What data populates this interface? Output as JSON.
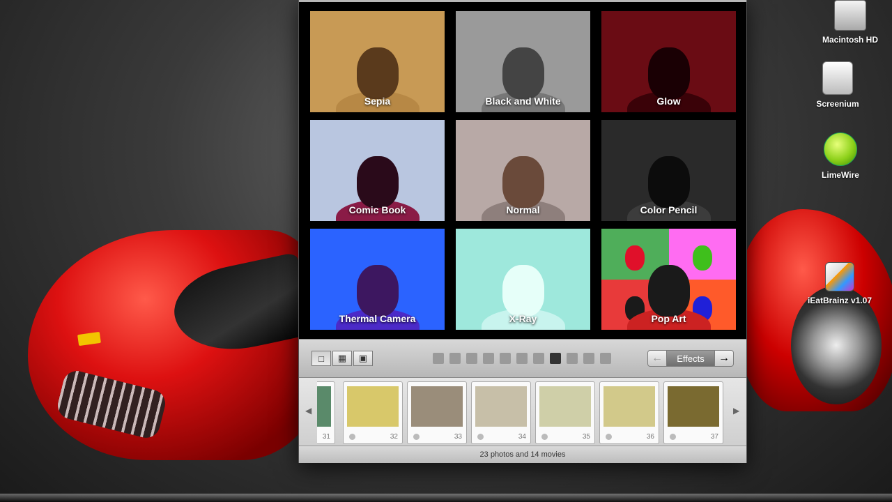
{
  "desktop": {
    "icons": [
      {
        "name": "Macintosh HD"
      },
      {
        "name": "Screenium"
      },
      {
        "name": "LimeWire"
      },
      {
        "name": "iEatBrainz v1.07"
      }
    ]
  },
  "effects": [
    {
      "label": "Sepia",
      "bg": "#c89a55",
      "face": "#5a3a1c",
      "shirt": "#b78845"
    },
    {
      "label": "Black and White",
      "bg": "#9a9a9a",
      "face": "#444444",
      "shirt": "#777777"
    },
    {
      "label": "Glow",
      "bg": "#6a0c14",
      "face": "#1a0004",
      "shirt": "#3a0208"
    },
    {
      "label": "Comic Book",
      "bg": "#b9c6e0",
      "face": "#2a0a1a",
      "shirt": "#8a1b46"
    },
    {
      "label": "Normal",
      "bg": "#b8a9a6",
      "face": "#6a4a3a",
      "shirt": "#8e7f7c"
    },
    {
      "label": "Color Pencil",
      "bg": "#2a2a2a",
      "face": "#0c0c0c",
      "shirt": "#3c3c3c"
    },
    {
      "label": "Thermal Camera",
      "bg": "#2b63ff",
      "face": "#3d1760",
      "shirt": "#4b2ac8"
    },
    {
      "label": "X-Ray",
      "bg": "#9ee8dc",
      "face": "#e6fff9",
      "shirt": "#c8f4ee"
    },
    {
      "label": "Pop Art",
      "bg": "#e83a3a",
      "face": "#1a1a1a",
      "shirt": "#c22"
    }
  ],
  "toolbar": {
    "effects_label": "Effects",
    "prev_icon": "arrow-left-icon",
    "next_icon": "arrow-right-icon",
    "page_count": 11,
    "current_page": 8,
    "view_buttons": [
      "single-view-icon",
      "grid-view-icon",
      "filmstrip-view-icon"
    ]
  },
  "tray": {
    "thumbnails": [
      {
        "num": "31",
        "color": "#5a8a6a"
      },
      {
        "num": "32",
        "color": "#d8c86a"
      },
      {
        "num": "33",
        "color": "#9a8d7a"
      },
      {
        "num": "34",
        "color": "#c7bfa8"
      },
      {
        "num": "35",
        "color": "#cfcfa8"
      },
      {
        "num": "36",
        "color": "#d2c98a"
      },
      {
        "num": "37",
        "color": "#7a6a30"
      }
    ],
    "status": "23 photos and 14 movies"
  }
}
